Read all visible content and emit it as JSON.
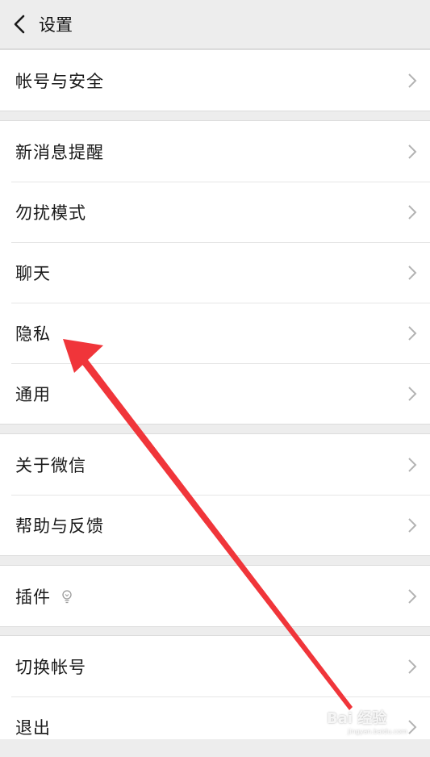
{
  "header": {
    "title": "设置",
    "back_icon": "chevron-left-icon"
  },
  "groups": [
    {
      "items": [
        {
          "label": "帐号与安全"
        }
      ]
    },
    {
      "items": [
        {
          "label": "新消息提醒"
        },
        {
          "label": "勿扰模式"
        },
        {
          "label": "聊天"
        },
        {
          "label": "隐私"
        },
        {
          "label": "通用"
        }
      ]
    },
    {
      "items": [
        {
          "label": "关于微信"
        },
        {
          "label": "帮助与反馈"
        }
      ]
    },
    {
      "items": [
        {
          "label": "插件",
          "icon": "lightbulb-icon"
        }
      ]
    },
    {
      "items": [
        {
          "label": "切换帐号"
        },
        {
          "label": "退出"
        }
      ]
    }
  ],
  "annotation": {
    "color": "#f0353a",
    "points_to": "隐私"
  },
  "watermark": {
    "main": "Bai 经验",
    "sub": "jingyan.baidu.com"
  },
  "colors": {
    "background": "#ededed",
    "cell": "#ffffff",
    "text": "#1a1a1a",
    "chevron": "#b2b2b2"
  }
}
